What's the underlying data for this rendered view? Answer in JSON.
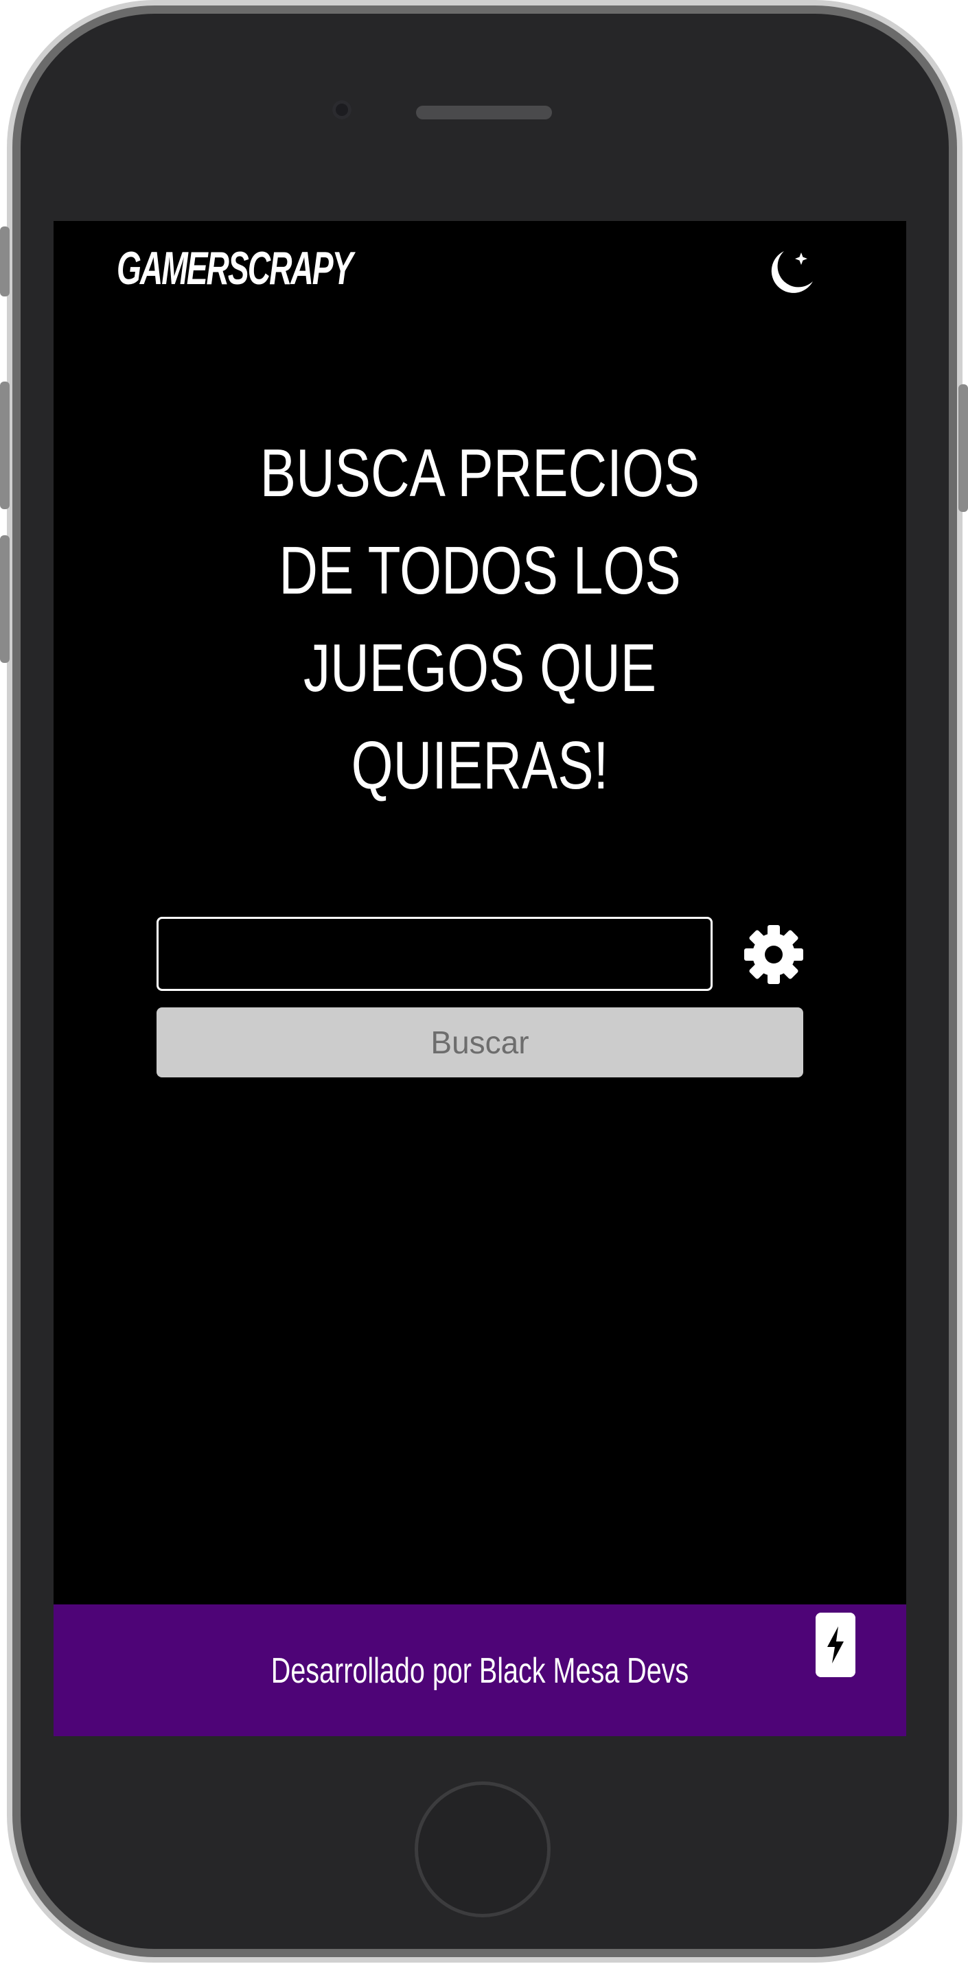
{
  "header": {
    "logo_text": "GAMERSCRAPY",
    "theme_toggle_icon": "moon-star-icon"
  },
  "hero": {
    "lines": [
      "BUSCA PRECIOS",
      "DE TODOS LOS",
      "JUEGOS QUE",
      "QUIERAS!"
    ]
  },
  "search": {
    "input_value": "",
    "placeholder": "",
    "settings_icon": "gear-icon",
    "button_label": "Buscar"
  },
  "footer": {
    "text": "Desarrollado por Black Mesa Devs",
    "action_icon": "lightning-bolt-icon"
  },
  "colors": {
    "background": "#000000",
    "text": "#ffffff",
    "footer": "#4e0477",
    "button": "#cccccc",
    "button_text": "#6d6d6d",
    "device_frame": "#262628"
  }
}
